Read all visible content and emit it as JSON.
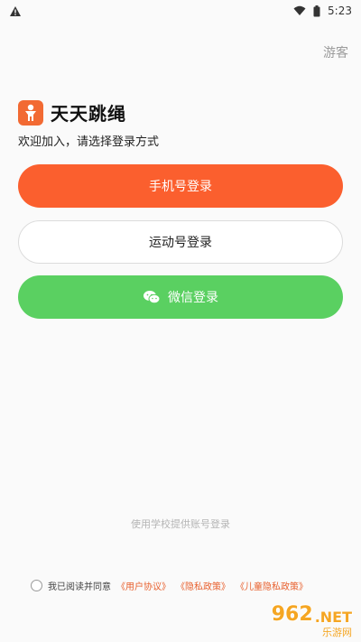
{
  "status_bar": {
    "time": "5:23"
  },
  "header": {
    "guest": "游客"
  },
  "brand": {
    "app_name": "天天跳绳",
    "welcome": "欢迎加入，请选择登录方式"
  },
  "buttons": {
    "phone_login": "手机号登录",
    "sport_login": "运动号登录",
    "wechat_login": "微信登录"
  },
  "school_login": "使用学校提供账号登录",
  "agreement": {
    "prefix": "我已阅读并同意",
    "user": "《用户协议》",
    "privacy": "《隐私政策》",
    "child_privacy": "《儿童隐私政策》"
  },
  "watermark": {
    "brand": "962",
    "suffix": ".NET",
    "site": "乐游网"
  },
  "colors": {
    "accent": "#fb5f2e",
    "wechat": "#5ad061",
    "link": "#e8612f"
  },
  "icons": {
    "status_warning": "warning-icon",
    "wifi": "wifi-icon",
    "battery": "battery-icon",
    "logo": "jump-rope-person-icon",
    "wechat": "wechat-icon"
  }
}
